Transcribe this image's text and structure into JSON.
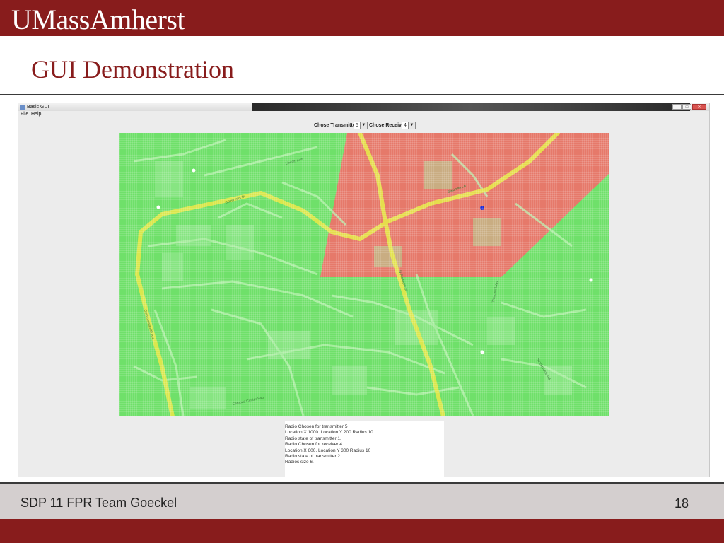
{
  "slide": {
    "logo": "UMassAmherst",
    "title": "GUI Demonstration",
    "footer_text": "SDP 11 FPR Team Goeckel",
    "page_number": "18"
  },
  "window": {
    "title": "Basic GUI",
    "menu": [
      "File",
      "Help"
    ],
    "controls": {
      "transmitter_label": "Chose Transmitter",
      "transmitter_value": "5",
      "receiver_label": "Chose Receiver",
      "receiver_value": "4"
    },
    "map": {
      "coverage_color": "#6fe06a",
      "shadow_color": "#f0706a",
      "receiver_marker_color": "#1f2bd6",
      "street_labels": [
        "Governors Dr",
        "Eastman Ln",
        "N Pleasant St",
        "Lincoln Ave",
        "Campus Center Way",
        "Commonwealth Ave",
        "Thatcher Way",
        "Stockbridge Rd"
      ]
    },
    "output_lines": [
      "Radio Chosen for transmitter 5",
      "Location X 1000. Location Y 200 Radius 10",
      "Radio state of transmitter 1.",
      "Radio Chosen for receiver 4.",
      "Location X 600. Location Y 300 Radius 10",
      "Radio state of transmitter 2.",
      "Radios size 6."
    ]
  },
  "colors": {
    "brand": "#881c1c",
    "footer_bg": "#d4cfcf"
  }
}
